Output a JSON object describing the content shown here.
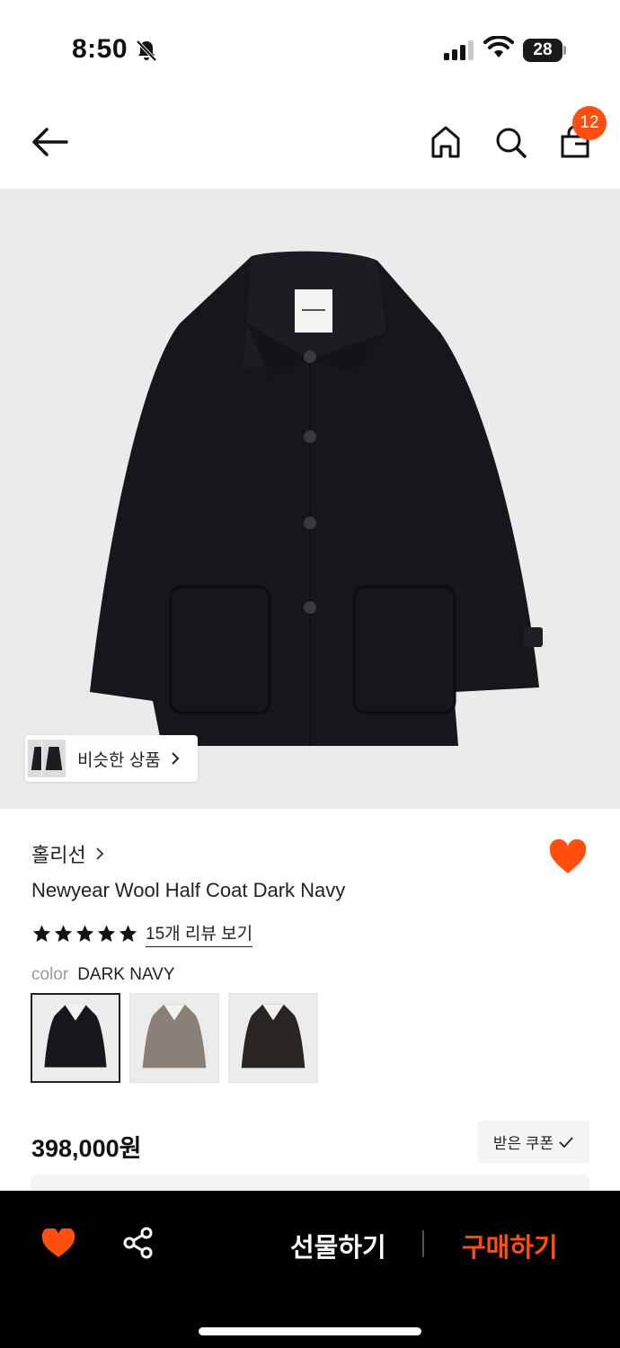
{
  "status_bar": {
    "time": "8:50",
    "battery": "28"
  },
  "header": {
    "cart_count": "12"
  },
  "product_image": {
    "similar_label": "비슷한 상품"
  },
  "product": {
    "brand": "홀리선",
    "name": "Newyear Wool Half Coat Dark Navy",
    "rating": 5,
    "review_link": "15개 리뷰 보기",
    "color_label": "color",
    "color_value": "DARK NAVY",
    "swatches": [
      {
        "name": "dark-navy",
        "color": "#15171c"
      },
      {
        "name": "taupe",
        "color": "#8a8078"
      },
      {
        "name": "dark-brown",
        "color": "#2a2422"
      }
    ],
    "price": "398,000원",
    "coupon_label": "받은 쿠폰"
  },
  "bottom_bar": {
    "gift_label": "선물하기",
    "buy_label": "구매하기",
    "accent_color": "#ff4e0d"
  }
}
